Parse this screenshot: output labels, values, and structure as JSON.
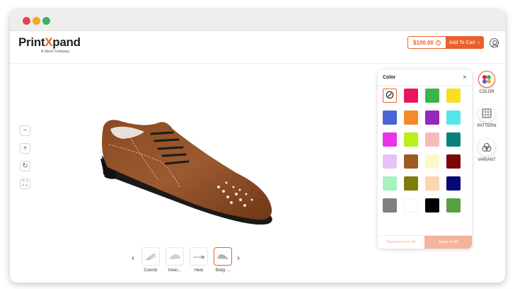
{
  "browser": {
    "dots": [
      "#e8414e",
      "#f5a623",
      "#3fb25f"
    ]
  },
  "header": {
    "logo_print": "Print",
    "logo_x": "X",
    "logo_pand": "pand",
    "logo_sub": "A Xtech Company",
    "price": "$100.00",
    "info_icon": "i",
    "cart_label": "Add To Cart",
    "cart_chevron": "›",
    "accent": "#e8612c"
  },
  "view_controls": [
    {
      "name": "zoom-out-button",
      "icon": "−"
    },
    {
      "name": "zoom-in-button",
      "icon": "+"
    },
    {
      "name": "reset-view-button",
      "icon": "↻"
    },
    {
      "name": "fullscreen-button",
      "icon": "⛶"
    }
  ],
  "color_panel": {
    "title": "Color",
    "close": "×",
    "none_symbol": "⊘",
    "swatches": [
      "#e8175d",
      "#3bb54a",
      "#f5e11f",
      "#4a64d6",
      "#f58a2a",
      "#9428b8",
      "#55e6ec",
      "#e834e6",
      "#b9ef1a",
      "#f6bcbc",
      "#07827d",
      "#e6c3f7",
      "#9c5c22",
      "#fdf8c8",
      "#7c0609",
      "#a6f3bd",
      "#7f7d0c",
      "#fcd6ae",
      "#050878",
      "#808080",
      "#ffffff",
      "#000000",
      "#58a03f"
    ],
    "remove_label": "Remove from All",
    "apply_label": "Apply to All"
  },
  "tools": {
    "color": "COLOR",
    "pattern": "PATTERN",
    "variant": "VARIANT"
  },
  "parts": {
    "prev": "‹",
    "next": "›",
    "items": [
      "Coords",
      "Inner...",
      "Heel",
      "Body ..."
    ]
  }
}
